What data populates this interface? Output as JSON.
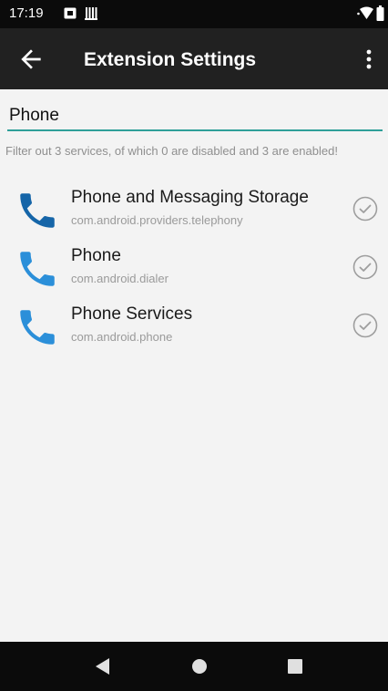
{
  "status_bar": {
    "time": "17:19",
    "icons": [
      "notification-icon",
      "sim-icon",
      "wifi-icon",
      "battery-icon"
    ]
  },
  "app_bar": {
    "title": "Extension Settings",
    "back_icon": "arrow-left-icon",
    "menu_icon": "more-vert-icon",
    "background": "#212121"
  },
  "search": {
    "value": "Phone",
    "underline_color": "#2e9f99"
  },
  "filter_summary": "Filter out 3 services, of which 0 are disabled and 3 are enabled!",
  "services": [
    {
      "name": "Phone and Messaging Storage",
      "package": "com.android.providers.telephony",
      "icon": "phone-icon",
      "status_icon": "check-circle-icon",
      "enabled": true
    },
    {
      "name": "Phone",
      "package": "com.android.dialer",
      "icon": "phone-icon",
      "status_icon": "check-circle-icon",
      "enabled": true
    },
    {
      "name": "Phone Services",
      "package": "com.android.phone",
      "icon": "phone-icon",
      "status_icon": "check-circle-icon",
      "enabled": true
    }
  ],
  "nav_bar": {
    "buttons": [
      "back-triangle-icon",
      "home-circle-icon",
      "recents-square-icon"
    ]
  },
  "colors": {
    "phone_icon_dark": "#1565a8",
    "phone_icon_light": "#2b8fd9",
    "check_grey": "#9e9e9e"
  }
}
